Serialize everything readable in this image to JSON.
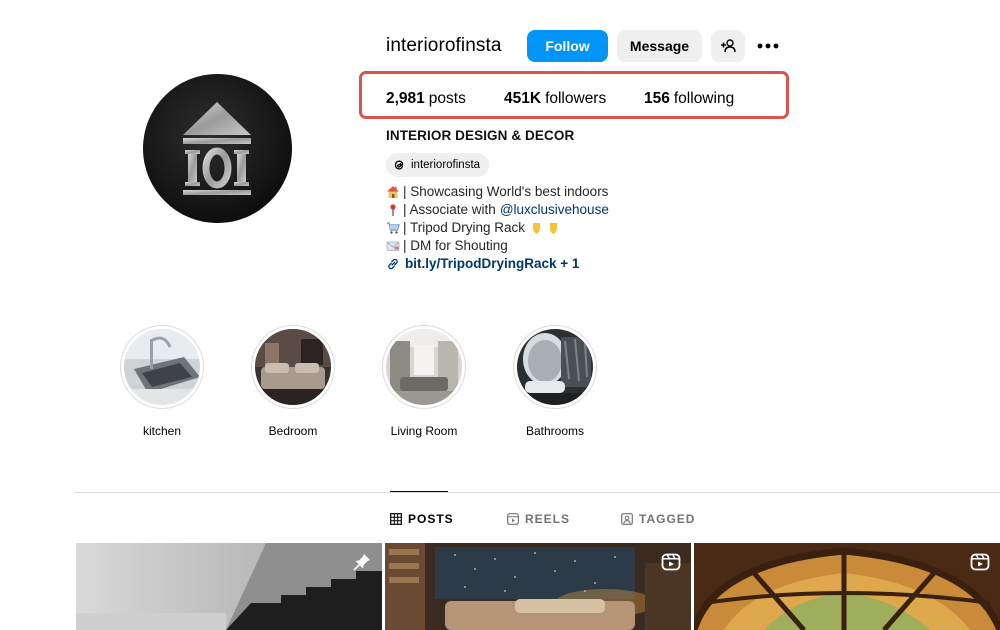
{
  "profile": {
    "username": "interiorofinsta",
    "full_name": "INTERIOR DESIGN & DECOR",
    "avatar_icon": "building-logo-icon"
  },
  "actions": {
    "follow_label": "Follow",
    "message_label": "Message",
    "add_user_icon": "add-user-icon",
    "more_label": "•••"
  },
  "stats": {
    "posts_count": "2,981",
    "posts_label": "posts",
    "followers_count": "451K",
    "followers_label": "followers",
    "following_count": "156",
    "following_label": "following"
  },
  "threads": {
    "handle": "interiorofinsta",
    "icon": "threads-icon"
  },
  "bio": {
    "line1": "| Showcasing World's best indoors",
    "line2_prefix": "| Associate with ",
    "line2_mention": "@luxclusivehouse",
    "line3": "| Tripod Drying Rack",
    "line4": "| DM for Shouting",
    "link": "bit.ly/TripodDryingRack + 1"
  },
  "highlights": [
    {
      "label": "kitchen"
    },
    {
      "label": "Bedroom"
    },
    {
      "label": "Living Room"
    },
    {
      "label": "Bathrooms"
    }
  ],
  "tabs": [
    {
      "label": "POSTS",
      "icon": "grid-icon",
      "active": true
    },
    {
      "label": "REELS",
      "icon": "reels-icon",
      "active": false
    },
    {
      "label": "TAGGED",
      "icon": "tagged-icon",
      "active": false
    }
  ],
  "posts": [
    {
      "badge": "pin-icon"
    },
    {
      "badge": "reel-icon"
    },
    {
      "badge": "reel-icon"
    }
  ],
  "colors": {
    "accent": "#0095f6",
    "highlight_box": "#d9534f",
    "link": "#00376b"
  }
}
